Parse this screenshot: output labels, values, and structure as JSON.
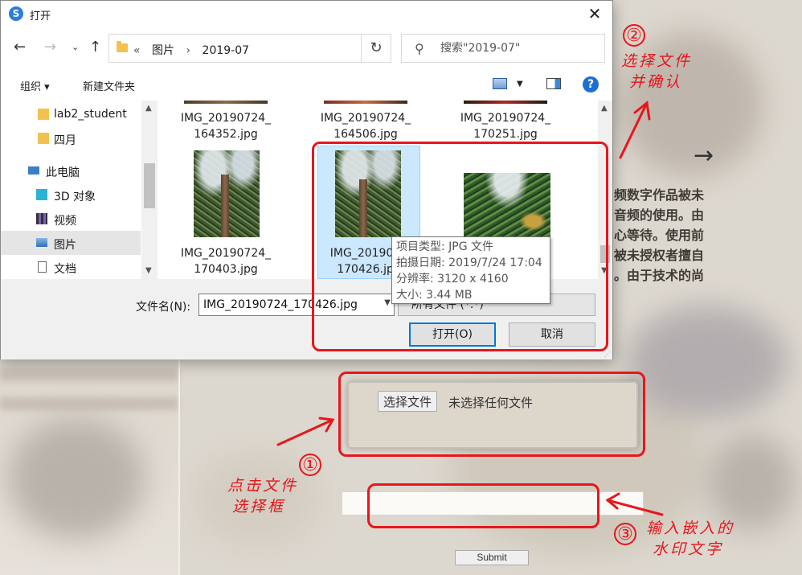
{
  "background_page": {
    "side_text_lines": [
      "频数字作品被未",
      "音频的使用。由",
      "心等待。使用前",
      "被未授权者擅自",
      "。由于技术的尚"
    ],
    "arrow_glyph": "→",
    "file_input": {
      "button_label": "选择文件",
      "status_text": "未选择任何文件"
    },
    "watermark_input": {
      "value": ""
    },
    "submit_label": "Submit"
  },
  "dialog": {
    "title": "打开",
    "app_icon": "sogou-icon",
    "address": {
      "crumb_prefix": "«",
      "crumbs": [
        "图片",
        "2019-07"
      ]
    },
    "search": {
      "placeholder": "搜索\"2019-07\""
    },
    "toolbar": {
      "organize_label": "组织 ▾",
      "new_folder_label": "新建文件夹"
    },
    "nav_items": [
      {
        "label": "lab2_student",
        "icon": "folder-icon"
      },
      {
        "label": "四月",
        "icon": "folder-icon"
      },
      {
        "label": "此电脑",
        "icon": "computer-icon"
      },
      {
        "label": "3D 对象",
        "icon": "3d-objects-icon"
      },
      {
        "label": "视频",
        "icon": "video-icon"
      },
      {
        "label": "图片",
        "icon": "pictures-icon"
      },
      {
        "label": "文档",
        "icon": "document-icon"
      }
    ],
    "files": [
      {
        "line1": "IMG_20190724_",
        "line2": "164352.jpg"
      },
      {
        "line1": "IMG_20190724_",
        "line2": "164506.jpg"
      },
      {
        "line1": "IMG_20190724_",
        "line2": "170251.jpg"
      },
      {
        "line1": "IMG_20190724_",
        "line2": "170403.jpg"
      },
      {
        "line1": "IMG_2019072",
        "line2": "170426.jpg"
      },
      {
        "line1": "",
        "line2": ""
      }
    ],
    "tooltip": {
      "type": "项目类型: JPG 文件",
      "date": "拍摄日期: 2019/7/24 17:04",
      "resolution": "分辨率: 3120 x 4160",
      "size": "大小: 3.44 MB"
    },
    "filename_label": "文件名(N):",
    "filename_value": "IMG_20190724_170426.jpg",
    "filter_value": "所有文件 (*.*)",
    "open_label": "打开(O)",
    "cancel_label": "取消"
  },
  "annotations": {
    "step1": {
      "num": "①",
      "lines": [
        "点击文件",
        "选择框"
      ]
    },
    "step2": {
      "num": "②",
      "lines": [
        "选择文件",
        "并确认"
      ]
    },
    "step3": {
      "num": "③",
      "lines": [
        "输入嵌入的",
        "水印文字"
      ]
    },
    "color": "#e8161b"
  }
}
